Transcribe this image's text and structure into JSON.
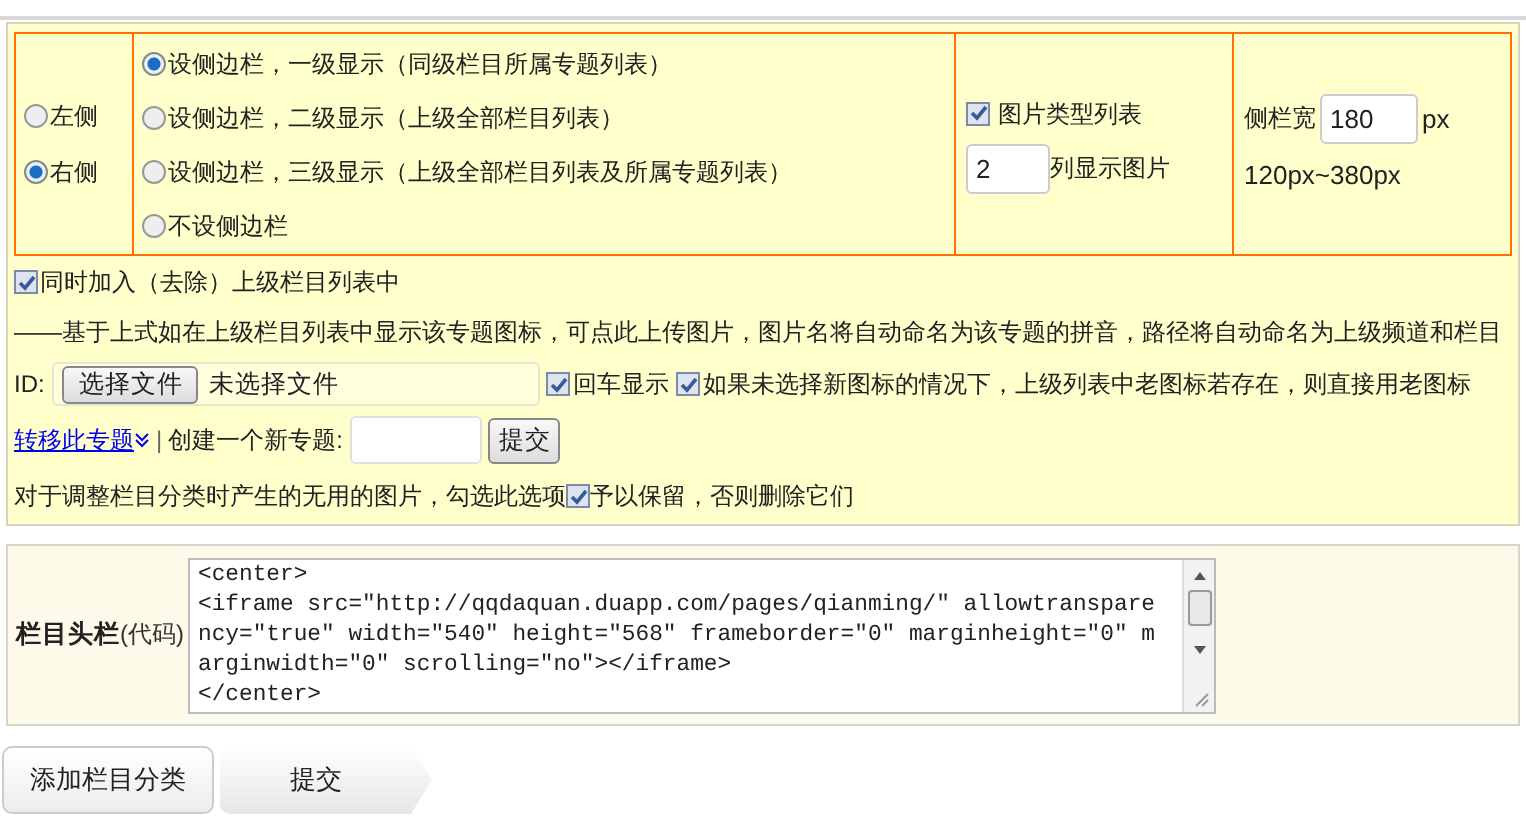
{
  "sidebar_position": [
    {
      "label": "左侧",
      "selected": false
    },
    {
      "label": "右侧",
      "selected": true
    }
  ],
  "sidebar_modes": [
    {
      "label": "设侧边栏，一级显示（同级栏目所属专题列表）",
      "selected": true
    },
    {
      "label": "设侧边栏，二级显示（上级全部栏目列表）",
      "selected": false
    },
    {
      "label": "设侧边栏，三级显示（上级全部栏目列表及所属专题列表）",
      "selected": false
    },
    {
      "label": "不设侧边栏",
      "selected": false
    }
  ],
  "image_list": {
    "label": "图片类型列表",
    "checked": true,
    "columns_value": "2",
    "columns_label": "列显示图片"
  },
  "sidebar_width": {
    "label": "侧栏宽",
    "value": "180",
    "unit": "px",
    "range": "120px~380px"
  },
  "add_to_parent": {
    "label": "同时加入（去除）上级栏目列表中",
    "checked": true
  },
  "upload_note": "——基于上式如在上级栏目列表中显示该专题图标，可点此上传图片，图片名将自动命名为该专题的拼音，路径将自动命名为上级频道和栏目",
  "id_label": "ID:",
  "file_button": "选择文件",
  "file_status": "未选择文件",
  "enter_display": {
    "label": "回车显示",
    "checked": true
  },
  "keep_old_icon": {
    "label": "如果未选择新图标的情况下，上级列表中老图标若存在，则直接用老图标",
    "checked": true
  },
  "move_link": "转移此专题",
  "separator": "|",
  "create_label": "创建一个新专题:",
  "create_submit": "提交",
  "cleanup": {
    "text": "对于调整栏目分类时产生的无用的图片，勾选此选项",
    "label": "予以保留，否则删除它们",
    "checked": true
  },
  "header_code": {
    "label": "栏目头栏",
    "label_suffix": "(代码)",
    "lines": [
      "<center>",
      "<iframe src=\"http://qqdaquan.duapp.com/pages/qianming/\" allowtranspare",
      "ncy=\"true\" width=\"540\" height=\"568\" frameborder=\"0\" marginheight=\"0\" m",
      "arginwidth=\"0\" scrolling=\"no\"></iframe>",
      "</center>"
    ]
  },
  "buttons": [
    "添加栏目分类",
    "提交"
  ]
}
